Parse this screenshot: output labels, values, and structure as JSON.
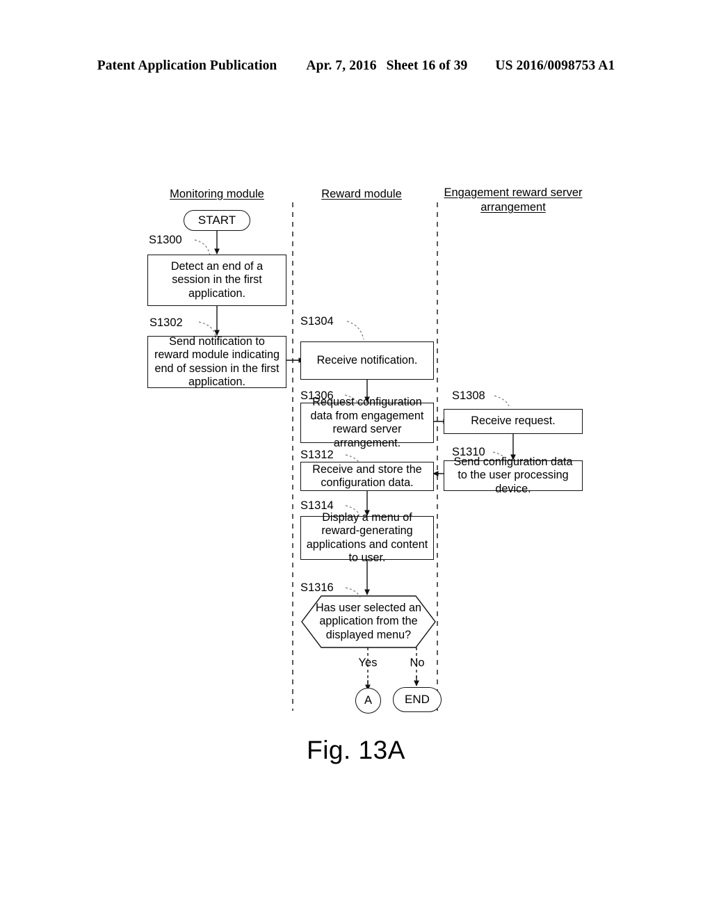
{
  "header": {
    "publication": "Patent Application Publication",
    "date": "Apr. 7, 2016",
    "sheet": "Sheet 16 of 39",
    "number": "US 2016/0098753 A1"
  },
  "figure": {
    "caption": "Fig. 13A",
    "lanes": [
      {
        "id": "monitoring",
        "title": "Monitoring module"
      },
      {
        "id": "reward",
        "title": "Reward module"
      },
      {
        "id": "server",
        "title": "Engagement reward server arrangement"
      }
    ],
    "terminators": {
      "start": "START",
      "end": "END",
      "connector_a": "A"
    },
    "branches": {
      "yes": "Yes",
      "no": "No"
    },
    "steps": [
      {
        "id": "S1300",
        "number": "S1300",
        "lane": "monitoring",
        "shape": "process",
        "text": "Detect an end of a session in the first application."
      },
      {
        "id": "S1302",
        "number": "S1302",
        "lane": "monitoring",
        "shape": "process",
        "text": "Send notification to reward module indicating end of session in the first application."
      },
      {
        "id": "S1304",
        "number": "S1304",
        "lane": "reward",
        "shape": "process",
        "text": "Receive notification."
      },
      {
        "id": "S1306",
        "number": "S1306",
        "lane": "reward",
        "shape": "process",
        "text": "Request configuration data from engagement reward server arrangement."
      },
      {
        "id": "S1308",
        "number": "S1308",
        "lane": "server",
        "shape": "process",
        "text": "Receive request."
      },
      {
        "id": "S1310",
        "number": "S1310",
        "lane": "server",
        "shape": "process",
        "text": "Send configuration data to the user processing device."
      },
      {
        "id": "S1312",
        "number": "S1312",
        "lane": "reward",
        "shape": "process",
        "text": "Receive and store the configuration data."
      },
      {
        "id": "S1314",
        "number": "S1314",
        "lane": "reward",
        "shape": "process",
        "text": "Display a menu of reward-generating applications and content to user."
      },
      {
        "id": "S1316",
        "number": "S1316",
        "lane": "reward",
        "shape": "decision",
        "text": "Has user selected an application from the displayed menu?"
      }
    ]
  },
  "colors": {
    "ink": "#111111",
    "paper": "#ffffff"
  }
}
